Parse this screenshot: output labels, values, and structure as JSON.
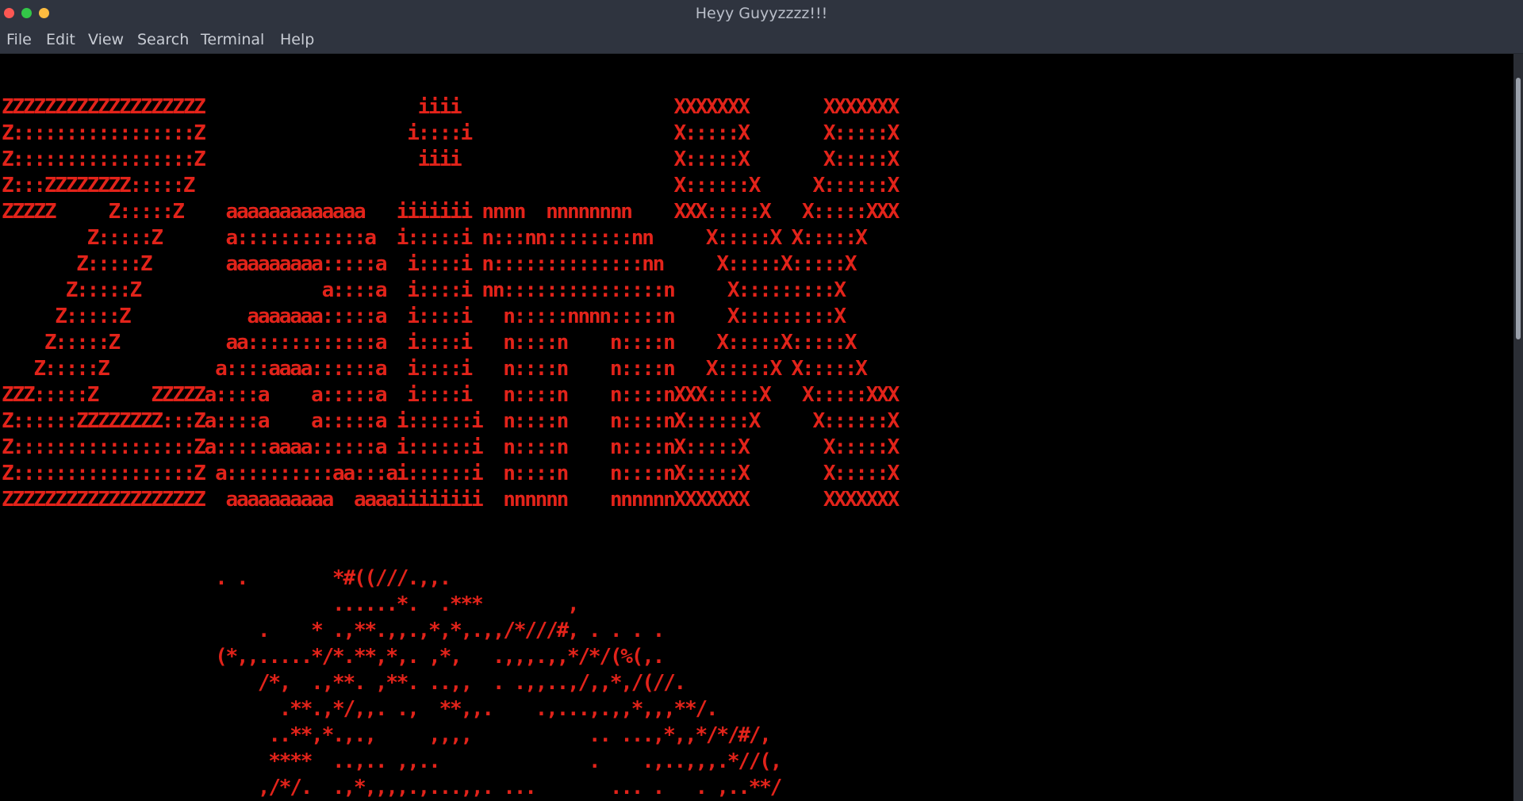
{
  "window": {
    "title": "Heyy Guyyzzzz!!!"
  },
  "menu": {
    "file": "File",
    "edit": "Edit",
    "view": "View",
    "search": "Search",
    "terminal": "Terminal",
    "help": "Help"
  },
  "terminal": {
    "text_color": "#e2231a",
    "background": "#000000",
    "lines": [
      "ZZZZZZZZZZZZZZZZZZZ                    iiii                    XXXXXXX       XXXXXXX",
      "Z:::::::::::::::::Z                   i::::i                   X:::::X       X:::::X",
      "Z:::::::::::::::::Z                    iiii                    X:::::X       X:::::X",
      "Z:::ZZZZZZZZ:::::Z                                             X::::::X     X::::::X",
      "ZZZZZ     Z:::::Z    aaaaaaaaaaaaa   iiiiiii nnnn  nnnnnnnn    XXX:::::X   X:::::XXX",
      "        Z:::::Z      a::::::::::::a  i:::::i n:::nn::::::::nn     X:::::X X:::::X",
      "       Z:::::Z       aaaaaaaaa:::::a  i::::i n::::::::::::::nn     X:::::X:::::X",
      "      Z:::::Z                 a::::a  i::::i nn:::::::::::::::n     X:::::::::X",
      "     Z:::::Z           aaaaaaa:::::a  i::::i   n:::::nnnn:::::n     X:::::::::X",
      "    Z:::::Z          aa::::::::::::a  i::::i   n::::n    n::::n    X:::::X:::::X",
      "   Z:::::Z          a::::aaaa::::::a  i::::i   n::::n    n::::n   X:::::X X:::::X",
      "ZZZ:::::Z     ZZZZZa::::a    a:::::a  i::::i   n::::n    n::::nXXX:::::X   X:::::XXX",
      "Z::::::ZZZZZZZZ:::Za::::a    a:::::a i::::::i  n::::n    n::::nX::::::X     X::::::X",
      "Z:::::::::::::::::Za:::::aaaa::::::a i::::::i  n::::n    n::::nX:::::X       X:::::X",
      "Z:::::::::::::::::Z a::::::::::aa:::ai::::::i  n::::n    n::::nX:::::X       X:::::X",
      "ZZZZZZZZZZZZZZZZZZZ  aaaaaaaaaa  aaaaiiiiiiii  nnnnnn    nnnnnnXXXXXXX       XXXXXXX",
      "",
      "",
      "                    . .        *#((///.,,.",
      "                               ......*.  .***        ,",
      "                        .    * .,**.,,.,*,*,.,,/*///#, . . . .",
      "                    (*,,.....*/*.**,*,. ,*,   .,,,.,,*/*/(%(,.",
      "                        /*,  .,**. ,**. ..,,  . .,,..,/,,*,/(//.",
      "                          .**.,*/,,. .,  **,,.    .,...,.,,*,,,**/.",
      "                         ..**,*.,.,     ,,,,           .. ...,*,,*/*/#/,",
      "                         ****  ..,.. ,,..              .    .,..,,,.*//(,",
      "                        ,/*/.  .,*,,,,.,...,,. ...       ... .   . ,..**/"
    ]
  }
}
